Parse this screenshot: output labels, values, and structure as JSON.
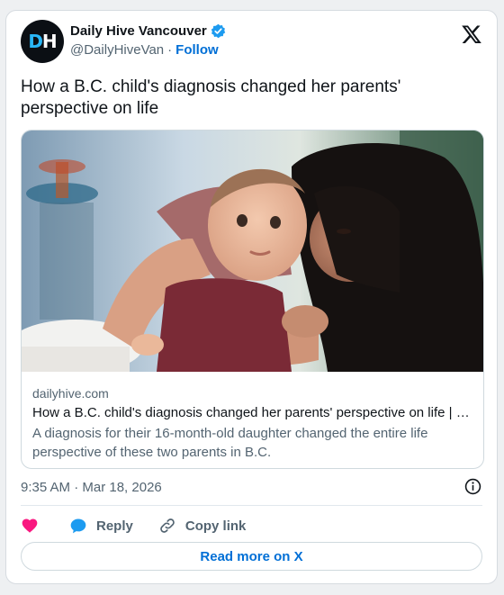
{
  "author": {
    "avatar_initials": "DH",
    "name": "Daily Hive Vancouver",
    "handle": "@DailyHiveVan",
    "separator": "·",
    "follow_label": "Follow"
  },
  "tweet": {
    "text": "How a B.C. child's diagnosis changed her parents' perspective on life",
    "timestamp": "9:35 AM · Mar 18, 2026"
  },
  "link_card": {
    "domain": "dailyhive.com",
    "title": "How a B.C. child's diagnosis changed her parents' perspective on life | …",
    "description": "A diagnosis for their 16-month-old daughter changed the entire life perspective of these two parents in B.C."
  },
  "actions": {
    "reply_label": "Reply",
    "copy_label": "Copy link",
    "read_more_label": "Read more on X"
  },
  "colors": {
    "accent": "#006fd6",
    "verified": "#1d9bf0",
    "like": "#f91880",
    "secondary_text": "#536471"
  },
  "icons": [
    "x-logo-icon",
    "verified-badge-icon",
    "info-icon",
    "heart-icon",
    "reply-bubble-icon",
    "link-icon"
  ]
}
